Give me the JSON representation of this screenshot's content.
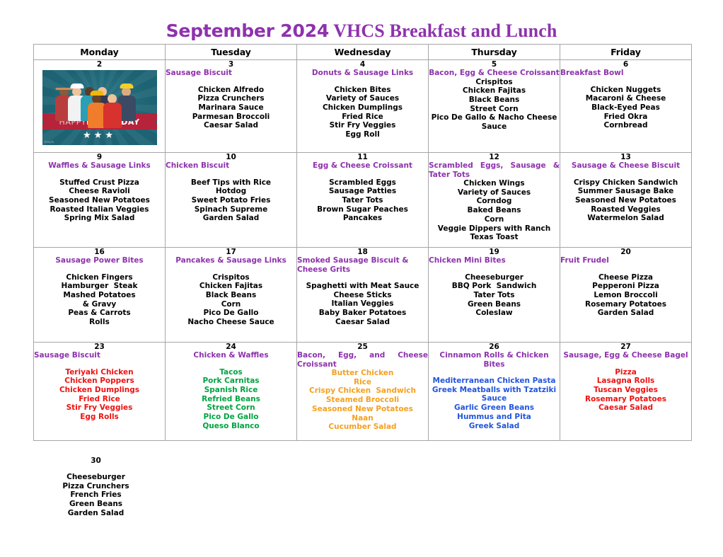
{
  "title": {
    "part1": "September 2024",
    "part2": " VHCS Breakfast and Lunch",
    "color": "#8e32ad"
  },
  "weekday_headers": [
    "Monday",
    "Tuesday",
    "Wednesday",
    "Thursday",
    "Friday"
  ],
  "colors": {
    "breakfast_purple": "#8e32ad",
    "default_black": "#000000",
    "red": "#ee1111",
    "green": "#00a340",
    "orange": "#f5a01e",
    "blue": "#2255dd",
    "grid": "#a6a6a6"
  },
  "labor_day_graphic": {
    "ribbon_text_light": "HAPPY ",
    "ribbon_text_bold": "LABOR DAY",
    "stars": "★★★",
    "watermark": "freepik",
    "background": "#1d6374",
    "ribbon_color": "#b5243a"
  },
  "weeks": [
    {
      "days": [
        {
          "number": "2",
          "breakfast": "",
          "lunch": "",
          "graphic": "labor-day"
        },
        {
          "number": "3",
          "breakfast": "Sausage Biscuit",
          "breakfast_align": "left",
          "lunch": "Chicken Alfredo\nPizza Crunchers\nMarinara Sauce\nParmesan Broccoli\nCaesar Salad",
          "lunch_gap": true
        },
        {
          "number": "4",
          "breakfast": "Donuts & Sausage Links",
          "breakfast_align": "center",
          "lunch": "Chicken Bites\nVariety of Sauces\nChicken Dumplings\nFried Rice\nStir Fry Veggies\nEgg Roll",
          "lunch_gap": true
        },
        {
          "number": "5",
          "breakfast": "Bacon, Egg & Cheese Croissant",
          "breakfast_align": "center",
          "lunch": "Crispitos\nChicken Fajitas\nBlack Beans\nStreet Corn\nPico De Gallo & Nacho Cheese\nSauce",
          "lunch_gap": false
        },
        {
          "number": "6",
          "breakfast": "Breakfast Bowl",
          "breakfast_align": "left",
          "lunch": "Chicken Nuggets\nMacaroni & Cheese\nBlack-Eyed Peas\nFried Okra\nCornbread",
          "lunch_gap": true
        }
      ]
    },
    {
      "days": [
        {
          "number": "9",
          "breakfast": "Waffles & Sausage Links",
          "breakfast_align": "center",
          "lunch": "Stuffed Crust Pizza\nCheese Ravioli\nSeasoned New Potatoes\nRoasted Italian Veggies\nSpring Mix Salad",
          "lunch_gap": true
        },
        {
          "number": "10",
          "breakfast": "Chicken Biscuit",
          "breakfast_align": "left",
          "lunch": "Beef Tips with Rice\nHotdog\nSweet Potato Fries\nSpinach Supreme\nGarden Salad",
          "lunch_gap": true
        },
        {
          "number": "11",
          "breakfast": "Egg & Cheese Croissant",
          "breakfast_align": "center",
          "lunch": "Scrambled Eggs\nSausage Patties\nTater Tots\nBrown Sugar Peaches\nPancakes",
          "lunch_gap": true
        },
        {
          "number": "12",
          "breakfast": "Scrambled Eggs, Sausage & Tater Tots",
          "breakfast_align": "justify",
          "lunch": "Chicken Wings\nVariety of Sauces\nCorndog\nBaked Beans\nCorn\nVeggie Dippers with Ranch\nTexas Toast",
          "lunch_gap": false
        },
        {
          "number": "13",
          "breakfast": "Sausage & Cheese Biscuit",
          "breakfast_align": "center",
          "lunch": "Crispy Chicken Sandwich\nSummer Sausage Bake\nSeasoned New Potatoes\nRoasted Veggies\nWatermelon Salad",
          "lunch_gap": true
        }
      ]
    },
    {
      "days": [
        {
          "number": "16",
          "breakfast": "Sausage Power Bites",
          "breakfast_align": "center",
          "lunch": "Chicken Fingers\nHamburger  Steak\nMashed Potatoes\n& Gravy\nPeas & Carrots\nRolls",
          "lunch_gap": true
        },
        {
          "number": "17",
          "breakfast": "Pancakes & Sausage Links",
          "breakfast_align": "center",
          "lunch": "Crispitos\nChicken Fajitas\nBlack Beans\nCorn\nPico De Gallo\nNacho Cheese Sauce",
          "lunch_gap": true
        },
        {
          "number": "18",
          "breakfast": "Smoked Sausage Biscuit & Cheese Grits",
          "breakfast_align": "left",
          "lunch": "Spaghetti with Meat Sauce\nCheese Sticks\nItalian Veggies\nBaby Baker Potatoes\nCaesar Salad",
          "lunch_gap": true
        },
        {
          "number": "19",
          "breakfast": "Chicken Mini Bites",
          "breakfast_align": "left",
          "lunch": "Cheeseburger\nBBQ Pork  Sandwich\nTater Tots\nGreen Beans\nColeslaw",
          "lunch_gap": true
        },
        {
          "number": "20",
          "breakfast": "Fruit Frudel",
          "breakfast_align": "left",
          "lunch": "Cheese Pizza\nPepperoni Pizza\nLemon Broccoli\nRosemary Potatoes\nGarden Salad",
          "lunch_gap": true
        }
      ]
    },
    {
      "days": [
        {
          "number": "23",
          "breakfast": "Sausage Biscuit",
          "breakfast_align": "left",
          "lunch": "Teriyaki Chicken\nChicken Poppers\nChicken Dumplings\nFried Rice\nStir Fry Veggies\nEgg Rolls",
          "lunch_color": "red",
          "lunch_gap": true
        },
        {
          "number": "24",
          "breakfast": "Chicken & Waffles",
          "breakfast_align": "center",
          "lunch": "Tacos\nPork Carnitas\nSpanish Rice\nRefried Beans\nStreet Corn\nPico De Gallo\nQueso Blanco",
          "lunch_color": "green",
          "lunch_gap": true
        },
        {
          "number": "25",
          "breakfast": "Bacon, Egg, and Cheese Croissant",
          "breakfast_align": "justify",
          "lunch": "Butter Chicken\nRice\nCrispy Chicken  Sandwich\nSteamed Broccoli\nSeasoned New Potatoes\nNaan\nCucumber Salad",
          "lunch_color": "orange",
          "lunch_gap": false
        },
        {
          "number": "26",
          "breakfast": "Cinnamon Rolls & Chicken Bites",
          "breakfast_align": "center",
          "lunch": "Mediterranean Chicken Pasta\nGreek Meatballs with Tzatziki\nSauce\nGarlic Green Beans\nHummus and Pita\nGreek Salad",
          "lunch_color": "blue",
          "lunch_gap": true
        },
        {
          "number": "27",
          "breakfast": "Sausage, Egg & Cheese Bagel",
          "breakfast_align": "center",
          "lunch": "Pizza\nLasagna Rolls\nTuscan Veggies\nRosemary Potatoes\nCaesar Salad",
          "lunch_color": "red",
          "lunch_gap": true
        }
      ]
    }
  ],
  "trailing_row": {
    "days": [
      {
        "number": "30",
        "breakfast": "",
        "lunch": "Cheeseburger\nPizza Crunchers\nFrench Fries\nGreen Beans\nGarden Salad",
        "lunch_gap": true
      }
    ]
  }
}
